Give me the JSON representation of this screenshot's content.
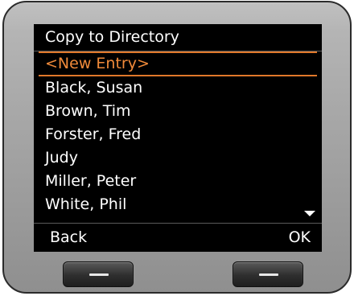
{
  "screen": {
    "title": "Copy to Directory",
    "entries": [
      {
        "label": "<New Entry>",
        "selected": true
      },
      {
        "label": "Black, Susan",
        "selected": false
      },
      {
        "label": "Brown, Tim",
        "selected": false
      },
      {
        "label": "Forster, Fred",
        "selected": false
      },
      {
        "label": "Judy",
        "selected": false
      },
      {
        "label": "Miller, Peter",
        "selected": false
      },
      {
        "label": "White, Phil",
        "selected": false
      }
    ],
    "scroll_indicator_icon": "triangle-down-icon",
    "softkeys": {
      "left": "Back",
      "right": "OK"
    }
  },
  "colors": {
    "screen_background": "#000000",
    "text": "#ffffff",
    "selection_accent": "#f08a3a",
    "device_body": "#a9a9a9"
  }
}
